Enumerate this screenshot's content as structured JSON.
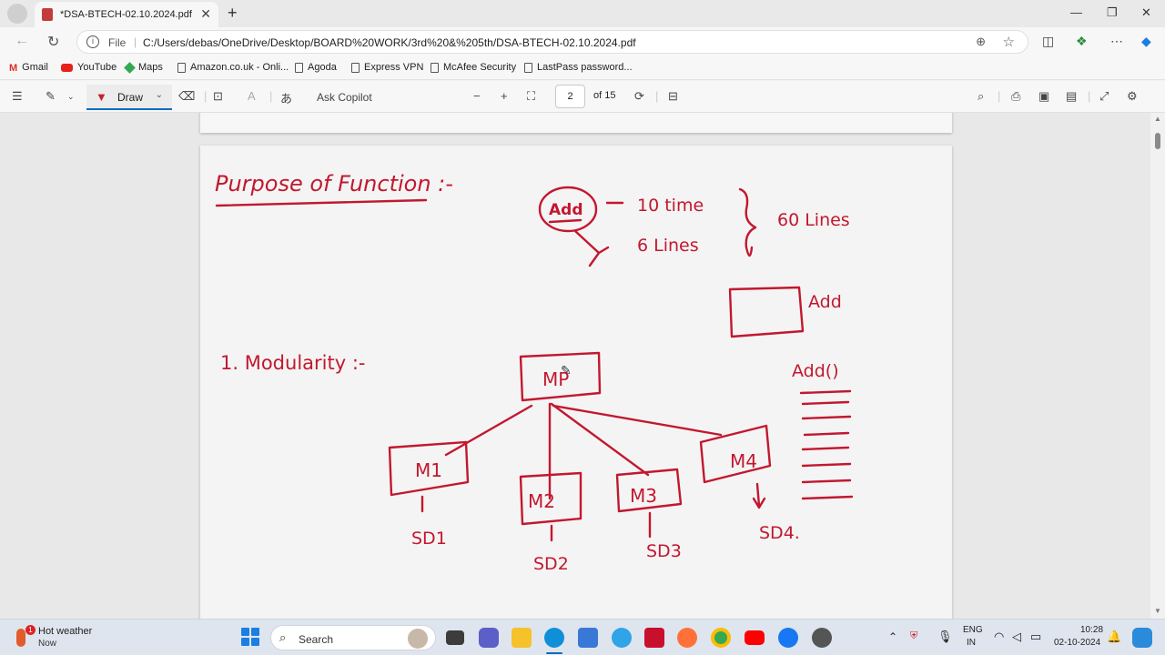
{
  "browser": {
    "tab_title": "*DSA-BTECH-02.10.2024.pdf",
    "file_label": "File",
    "url": "C:/Users/debas/OneDrive/Desktop/BOARD%20WORK/3rd%20&%205th/DSA-BTECH-02.10.2024.pdf"
  },
  "bookmarks": [
    "Gmail",
    "YouTube",
    "Maps",
    "Amazon.co.uk - Onli...",
    "Agoda",
    "Express VPN",
    "McAfee Security",
    "LastPass password..."
  ],
  "pdf_toolbar": {
    "draw_label": "Draw",
    "ask_copilot": "Ask Copilot",
    "current_page": "2",
    "of_pages": "of 15"
  },
  "notes": {
    "heading": "Purpose of Function :-",
    "add_box": "Add",
    "ten_time": "10 time",
    "six_lines": "6 Lines",
    "sixty_lines": "60 Lines",
    "add_label": "Add",
    "add_func": "Add()",
    "modularity": "1. Modularity :-",
    "main_module": "MP",
    "modules": [
      "M1",
      "M2",
      "M3",
      "M4"
    ],
    "subdivisions": [
      "SD1",
      "SD2",
      "SD3",
      "SD4."
    ]
  },
  "taskbar": {
    "weather_title": "Hot weather",
    "weather_sub": "Now",
    "weather_badge": "1",
    "search_label": "Search",
    "lang_top": "ENG",
    "lang_bottom": "IN",
    "time": "10:28",
    "date": "02-10-2024"
  }
}
